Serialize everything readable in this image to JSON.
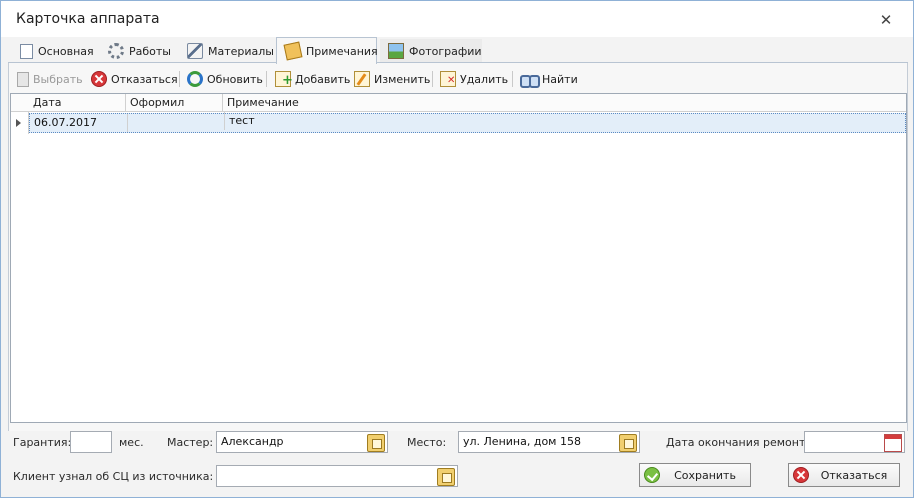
{
  "window": {
    "title": "Карточка аппарата"
  },
  "tabs": [
    {
      "label": "Основная",
      "icon": "page-icon"
    },
    {
      "label": "Работы",
      "icon": "gear-icon"
    },
    {
      "label": "Материалы",
      "icon": "tools-icon"
    },
    {
      "label": "Примечания",
      "icon": "note-icon",
      "active": true
    },
    {
      "label": "Фотографии",
      "icon": "photo-icon"
    }
  ],
  "toolbar": {
    "select": "Выбрать",
    "cancel": "Отказаться",
    "refresh": "Обновить",
    "add": "Добавить",
    "edit": "Изменить",
    "delete": "Удалить",
    "find": "Найти"
  },
  "grid": {
    "columns": [
      "Дата",
      "Оформил",
      "Примечание"
    ],
    "rows": [
      {
        "date": "06.07.2017",
        "author": "",
        "note": "тест"
      }
    ]
  },
  "form": {
    "warranty_label": "Гарантия:",
    "warranty_value": "",
    "warranty_unit": "мес.",
    "master_label": "Мастер:",
    "master_value": "Александр",
    "place_label": "Место:",
    "place_value": "ул. Ленина, дом 158",
    "repair_end_label": "Дата окончания ремонта:",
    "repair_end_value": "",
    "source_label": "Клиент узнал об СЦ из источника:",
    "source_value": ""
  },
  "buttons": {
    "save": "Сохранить",
    "cancel": "Отказаться"
  },
  "colors": {
    "selection": "#e3eef9",
    "border": "#8fb1d6"
  }
}
